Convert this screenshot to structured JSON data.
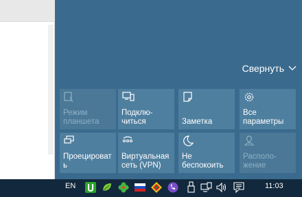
{
  "action_center": {
    "collapse_label": "Свернуть",
    "tiles": [
      {
        "label": "Режим\nпланшета",
        "icon": "tablet-mode-icon",
        "enabled": false
      },
      {
        "label": "Подклю-\nчиться",
        "icon": "connect-icon",
        "enabled": true
      },
      {
        "label": "Заметка",
        "icon": "note-icon",
        "enabled": true
      },
      {
        "label": "Все\nпараметры",
        "icon": "gear-icon",
        "enabled": true
      },
      {
        "label": "Проецироват\nь",
        "icon": "project-icon",
        "enabled": true
      },
      {
        "label": "Виртуальная\nсеть (VPN)",
        "icon": "vpn-icon",
        "enabled": true
      },
      {
        "label": "Не\nбеспокоить",
        "icon": "moon-icon",
        "enabled": true
      },
      {
        "label": "Располо-\nжение",
        "icon": "location-icon",
        "enabled": false
      }
    ]
  },
  "taskbar": {
    "language": "EN",
    "time": "11:03",
    "tray_icons": [
      "utorrent-icon",
      "leaf-icon",
      "clover-icon",
      "flag-icon",
      "diamond-icon",
      "viber-icon",
      "usb-icon",
      "network-icon",
      "volume-icon",
      "notifications-icon"
    ]
  },
  "colors": {
    "action_center_bg": "#3a6b8e",
    "tile_bg": "#4f7f9f",
    "taskbar_bg": "#12283c"
  }
}
